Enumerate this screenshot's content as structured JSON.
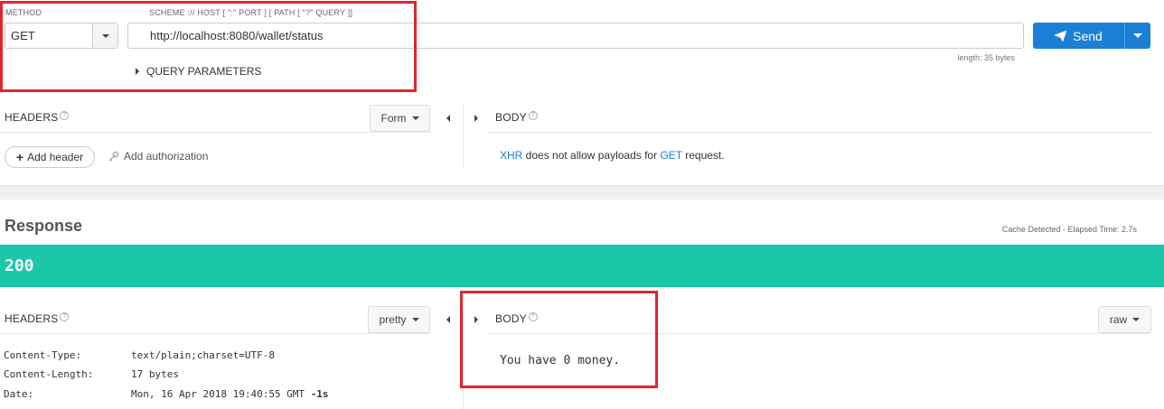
{
  "request": {
    "method_label": "METHOD",
    "method_value": "GET",
    "url_label": "SCHEME :// HOST [ \":\" PORT ] [ PATH [ \"?\" QUERY ]]",
    "url_value": "http://localhost:8080/wallet/status",
    "query_params_label": "QUERY PARAMETERS",
    "length_text": "length: 35 bytes",
    "send_label": "Send",
    "headers_label": "HEADERS",
    "form_label": "Form",
    "body_label": "BODY",
    "add_header_label": "Add header",
    "add_auth_label": "Add authorization",
    "body_msg_xhr": "XHR",
    "body_msg_mid": " does not allow payloads for ",
    "body_msg_get": "GET",
    "body_msg_end": " request."
  },
  "response": {
    "title": "Response",
    "cache_text": "Cache Detected - Elapsed Time: 2.7s",
    "status_code": "200",
    "status_color": "#1cc6a8",
    "headers_label": "HEADERS",
    "pretty_label": "pretty",
    "body_label": "BODY",
    "raw_label": "raw",
    "headers": [
      {
        "name": "Content-Type:",
        "value": "text/plain;charset=UTF-8"
      },
      {
        "name": "Content-Length:",
        "value": "17 bytes"
      },
      {
        "name": "Date:",
        "value": "Mon, 16 Apr 2018 19:40:55 GMT",
        "suffix": "-1s"
      }
    ],
    "body_text": "You have 0 money."
  },
  "colors": {
    "accent": "#1a7fd6",
    "annotation": "#e0262e"
  }
}
